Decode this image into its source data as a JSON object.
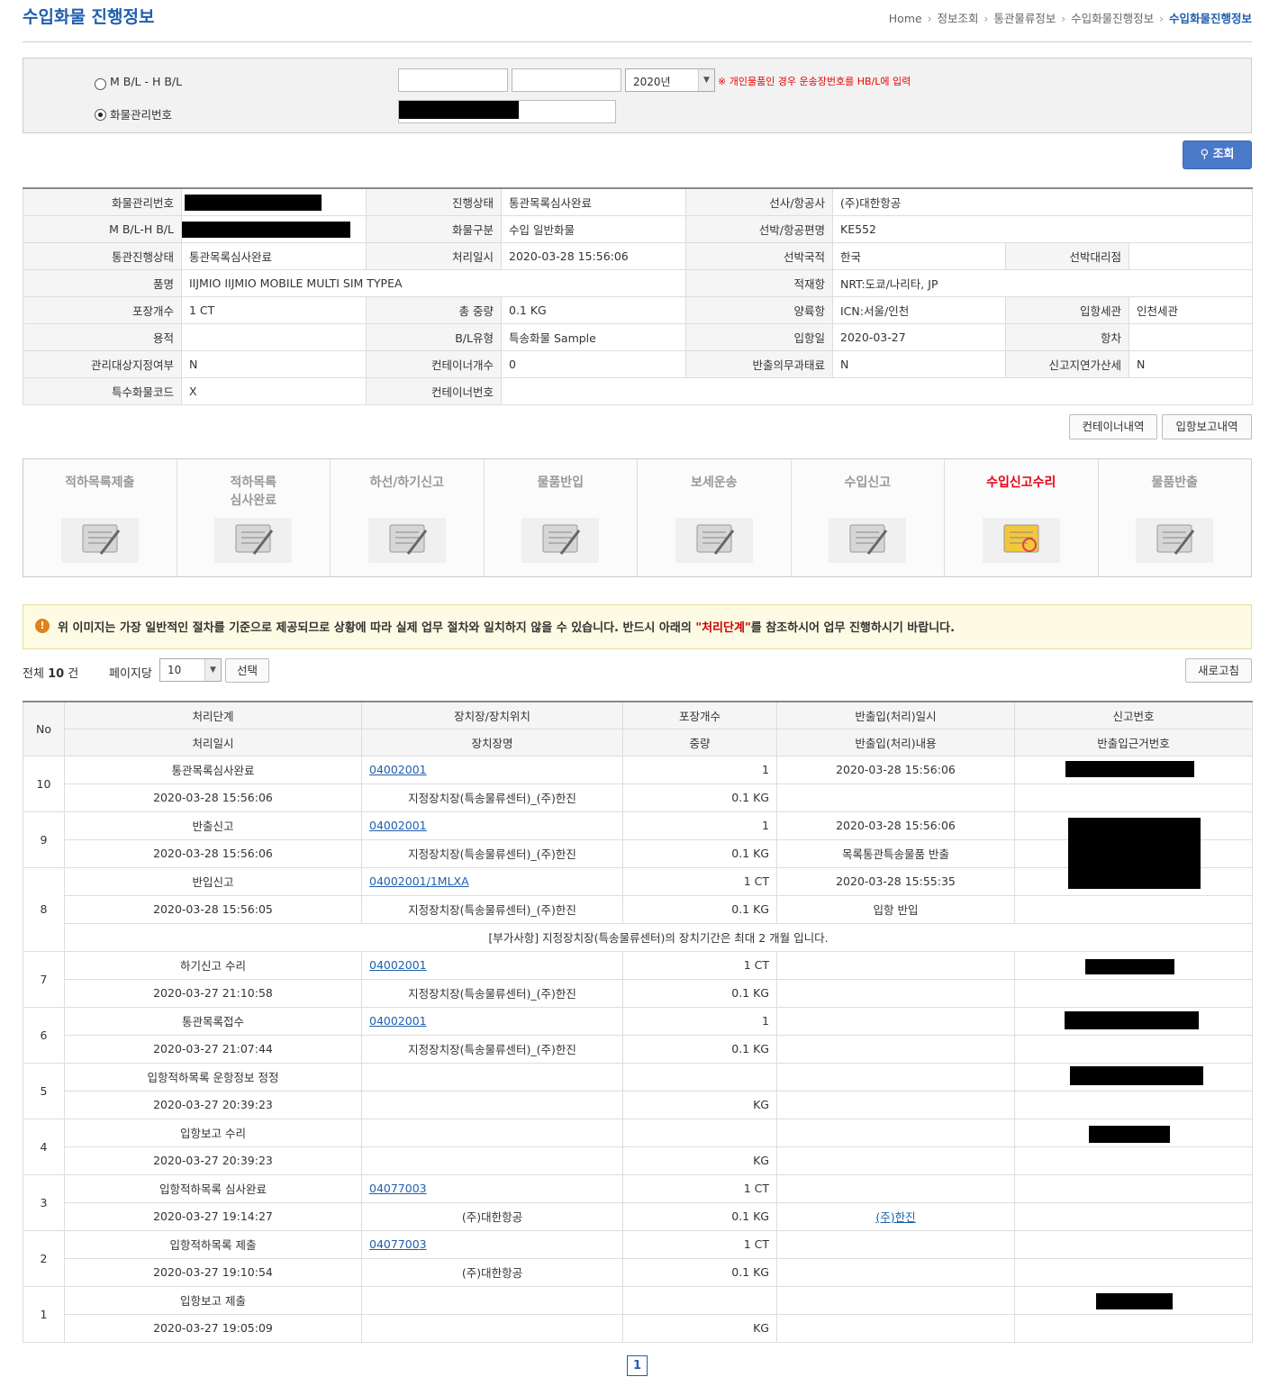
{
  "page_title": "수입화물 진행정보",
  "breadcrumb": [
    "Home",
    "정보조회",
    "통관물류정보",
    "수입화물진행정보",
    "수입화물진행정보"
  ],
  "search": {
    "option_bl": "M B/L - H B/L",
    "option_cargo": "화물관리번호",
    "year_value": "2020년",
    "note": "※ 개인물품인 경우 운송장번호를 HB/L에 입력",
    "search_button": "조회"
  },
  "info": {
    "cargo_no_label": "화물관리번호",
    "status_label": "진행상태",
    "status": "통관목록심사완료",
    "carrier_label": "선사/항공사",
    "carrier": "(주)대한항공",
    "bl_label": "M B/L-H B/L",
    "cargo_type_label": "화물구분",
    "cargo_type": "수입 일반화물",
    "flight_label": "선박/항공편명",
    "flight": "KE552",
    "customs_status_label": "통관진행상태",
    "customs_status": "통관목록심사완료",
    "processed_label": "처리일시",
    "processed": "2020-03-28 15:56:06",
    "nationality_label": "선박국적",
    "nationality": "한국",
    "agent_label": "선박대리점",
    "agent": "",
    "item_label": "품명",
    "item": "IIJMIO IIJMIO MOBILE MULTI SIM TYPEA",
    "loading_port_label": "적재항",
    "loading_port": "NRT:도쿄/나리타, JP",
    "packages_label": "포장개수",
    "packages": "1 CT",
    "weight_label": "총 중량",
    "weight": "0.1 KG",
    "unloading_port_label": "양륙항",
    "unloading_port": "ICN:서울/인천",
    "entry_customs_label": "입항세관",
    "entry_customs": "인천세관",
    "volume_label": "용적",
    "volume": "",
    "bl_type_label": "B/L유형",
    "bl_type": "특송화물 Sample",
    "arrival_label": "입항일",
    "arrival": "2020-03-27",
    "voyage_label": "항차",
    "voyage": "",
    "managed_label": "관리대상지정여부",
    "managed": "N",
    "container_count_label": "컨테이너개수",
    "container_count": "0",
    "release_fine_label": "반출의무과태료",
    "release_fine": "N",
    "late_tax_label": "신고지연가산세",
    "late_tax": "N",
    "special_code_label": "특수화물코드",
    "special_code": "X",
    "container_no_label": "컨테이너번호",
    "container_no": ""
  },
  "buttons": {
    "containers": "컨테이너내역",
    "arrival_report": "입항보고내역",
    "refresh": "새로고침",
    "select": "선택"
  },
  "steps": [
    {
      "label": "적하목록제출",
      "icon": "clipboard-icon"
    },
    {
      "label": "적하목록\n심사완료",
      "icon": "stamp-icon"
    },
    {
      "label": "하선/하기신고",
      "icon": "folder-icon"
    },
    {
      "label": "물품반입",
      "icon": "boxes-icon"
    },
    {
      "label": "보세운송",
      "icon": "truck-icon"
    },
    {
      "label": "수입신고",
      "icon": "document-pen-icon"
    },
    {
      "label": "수입신고수리",
      "icon": "approved-document-icon",
      "active": true
    },
    {
      "label": "물품반출",
      "icon": "release-stamp-icon"
    }
  ],
  "notice": {
    "pre": "위 이미지는 가장 일반적인 절차를 기준으로 제공되므로 상황에 따라 실제 업무 절차와 일치하지 않을 수 있습니다. 반드시 아래의 ",
    "highlight": "\"처리단계\"",
    "post": "를 참조하시어 업무 진행하시기 바랍니다."
  },
  "list_meta": {
    "total_prefix": "전체",
    "total": "10",
    "total_suffix": "건",
    "perpage_label": "페이지당",
    "perpage_value": "10",
    "page": "1"
  },
  "list_headers": {
    "no": "No",
    "r1": [
      "처리단계",
      "장치장/장치위치",
      "포장개수",
      "반출입(처리)일시",
      "신고번호"
    ],
    "r2": [
      "처리일시",
      "장치장명",
      "중량",
      "반출입(처리)내용",
      "반출입근거번호"
    ]
  },
  "rows": [
    {
      "no": "10",
      "step": "통관목록심사완료",
      "loc": "04002001",
      "pkg": "1",
      "io_time": "2020-03-28 15:56:06",
      "time": "2020-03-28 15:56:06",
      "loc_name": "지정장치장(특송물류센터)_(주)한진",
      "weight": "0.1 KG",
      "io_desc": ""
    },
    {
      "no": "9",
      "step": "반출신고",
      "loc": "04002001",
      "pkg": "1",
      "io_time": "2020-03-28 15:56:06",
      "time": "2020-03-28 15:56:06",
      "loc_name": "지정장치장(특송물류센터)_(주)한진",
      "weight": "0.1 KG",
      "io_desc": "목록통관특송물품 반출"
    },
    {
      "no": "8",
      "step": "반입신고",
      "loc": "04002001/1MLXA",
      "pkg": "1 CT",
      "io_time": "2020-03-28 15:55:35",
      "time": "2020-03-28 15:56:05",
      "loc_name": "지정장치장(특송물류센터)_(주)한진",
      "weight": "0.1 KG",
      "io_desc": "입항 반입",
      "extra": "[부가사항] 지정장치장(특송물류센터)의 장치기간은 최대 2 개월 입니다."
    },
    {
      "no": "7",
      "step": "하기신고 수리",
      "loc": "04002001",
      "pkg": "1 CT",
      "io_time": "",
      "time": "2020-03-27 21:10:58",
      "loc_name": "지정장치장(특송물류센터)_(주)한진",
      "weight": "0.1 KG",
      "io_desc": ""
    },
    {
      "no": "6",
      "step": "통관목록접수",
      "loc": "04002001",
      "pkg": "1",
      "io_time": "",
      "time": "2020-03-27 21:07:44",
      "loc_name": "지정장치장(특송물류센터)_(주)한진",
      "weight": "0.1 KG",
      "io_desc": ""
    },
    {
      "no": "5",
      "step": "입항적하목록 운항정보 정정",
      "loc": "",
      "pkg": "",
      "io_time": "",
      "time": "2020-03-27 20:39:23",
      "loc_name": "",
      "weight": "KG",
      "io_desc": ""
    },
    {
      "no": "4",
      "step": "입항보고 수리",
      "loc": "",
      "pkg": "",
      "io_time": "",
      "time": "2020-03-27 20:39:23",
      "loc_name": "",
      "weight": "KG",
      "io_desc": ""
    },
    {
      "no": "3",
      "step": "입항적하목록 심사완료",
      "loc": "04077003",
      "pkg": "1 CT",
      "io_time": "",
      "time": "2020-03-27 19:14:27",
      "loc_name": "(주)대한항공",
      "weight": "0.1 KG",
      "io_desc": "(주)한진",
      "io_desc_link": true
    },
    {
      "no": "2",
      "step": "입항적하목록 제출",
      "loc": "04077003",
      "pkg": "1 CT",
      "io_time": "",
      "time": "2020-03-27 19:10:54",
      "loc_name": "(주)대한항공",
      "weight": "0.1 KG",
      "io_desc": ""
    },
    {
      "no": "1",
      "step": "입항보고 제출",
      "loc": "",
      "pkg": "",
      "io_time": "",
      "time": "2020-03-27 19:05:09",
      "loc_name": "",
      "weight": "KG",
      "io_desc": ""
    }
  ]
}
